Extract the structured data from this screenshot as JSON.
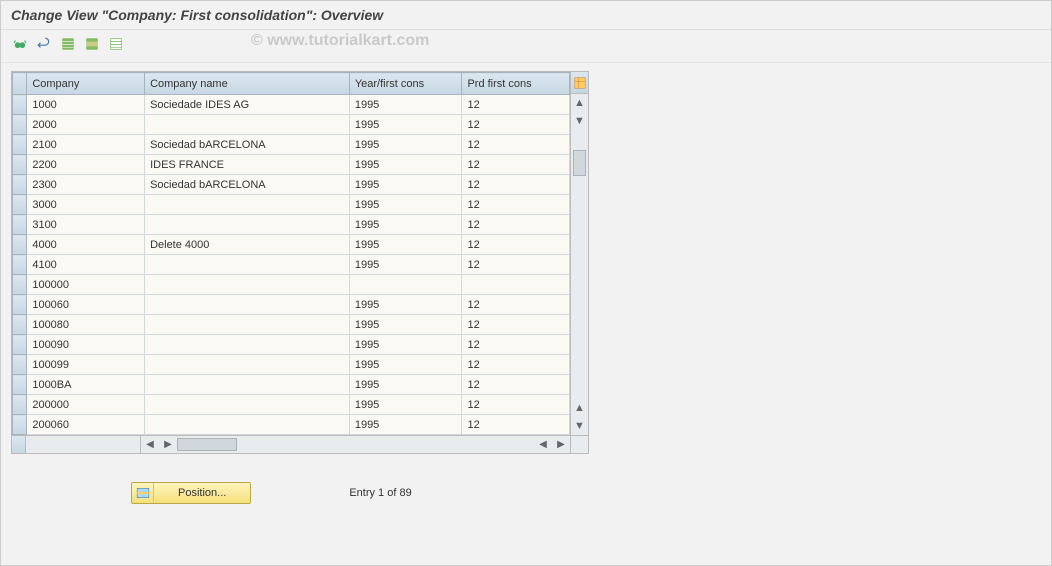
{
  "title": "Change View \"Company: First consolidation\": Overview",
  "watermark": "© www.tutorialkart.com",
  "toolbar": {
    "other_view": "Other view",
    "undo": "Undo changes",
    "select_all": "Select all",
    "select_block": "Select block",
    "deselect_all": "Deselect all"
  },
  "table": {
    "headers": {
      "company": "Company",
      "company_name": "Company name",
      "year_first_cons": "Year/first cons",
      "prd_first_cons": "Prd first cons",
      "config": "Table settings"
    },
    "rows": [
      {
        "company": "1000",
        "name": "Sociedade IDES AG",
        "year": "1995",
        "prd": "12"
      },
      {
        "company": "2000",
        "name": "",
        "year": "1995",
        "prd": "12"
      },
      {
        "company": "2100",
        "name": "Sociedad bARCELONA",
        "year": "1995",
        "prd": "12"
      },
      {
        "company": "2200",
        "name": "IDES FRANCE",
        "year": "1995",
        "prd": "12"
      },
      {
        "company": "2300",
        "name": "Sociedad bARCELONA",
        "year": "1995",
        "prd": "12"
      },
      {
        "company": "3000",
        "name": "",
        "year": "1995",
        "prd": "12"
      },
      {
        "company": "3100",
        "name": "",
        "year": "1995",
        "prd": "12"
      },
      {
        "company": "4000",
        "name": "Delete 4000",
        "year": "1995",
        "prd": "12"
      },
      {
        "company": "4100",
        "name": "",
        "year": "1995",
        "prd": "12"
      },
      {
        "company": "100000",
        "name": "",
        "year": "",
        "prd": ""
      },
      {
        "company": "100060",
        "name": "",
        "year": "1995",
        "prd": "12"
      },
      {
        "company": "100080",
        "name": "",
        "year": "1995",
        "prd": "12"
      },
      {
        "company": "100090",
        "name": "",
        "year": "1995",
        "prd": "12"
      },
      {
        "company": "100099",
        "name": "",
        "year": "1995",
        "prd": "12"
      },
      {
        "company": "1000BA",
        "name": "",
        "year": "1995",
        "prd": "12"
      },
      {
        "company": "200000",
        "name": "",
        "year": "1995",
        "prd": "12"
      },
      {
        "company": "200060",
        "name": "",
        "year": "1995",
        "prd": "12"
      }
    ]
  },
  "footer": {
    "position_button": "Position...",
    "entry_text": "Entry 1 of 89"
  }
}
